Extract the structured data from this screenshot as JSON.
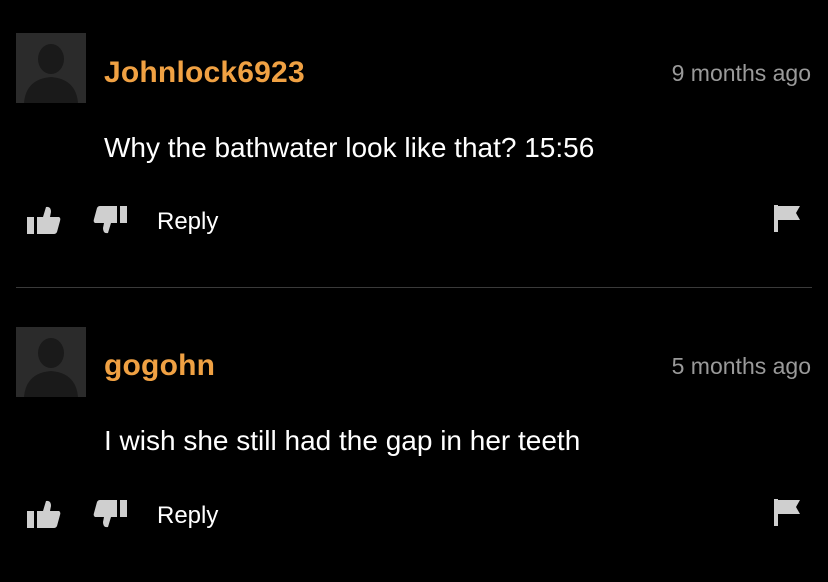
{
  "comments": [
    {
      "username": "Johnlock6923",
      "time": "9 months ago",
      "text": "Why the bathwater look like that? 15:56",
      "reply_label": "Reply"
    },
    {
      "username": "gogohn",
      "time": "5 months ago",
      "text": "I wish she still had the gap in her teeth",
      "reply_label": "Reply"
    }
  ],
  "icons": {
    "avatar": "user-avatar-icon",
    "upvote": "thumbs-up-icon",
    "downvote": "thumbs-down-icon",
    "report": "flag-icon"
  },
  "colors": {
    "background": "#000000",
    "username": "#f0a143",
    "timestamp": "#9a9a9a",
    "text": "#ffffff",
    "icon": "#cfcfcf",
    "avatar_bg": "#2b2b2b",
    "divider": "#3a3a3a"
  }
}
